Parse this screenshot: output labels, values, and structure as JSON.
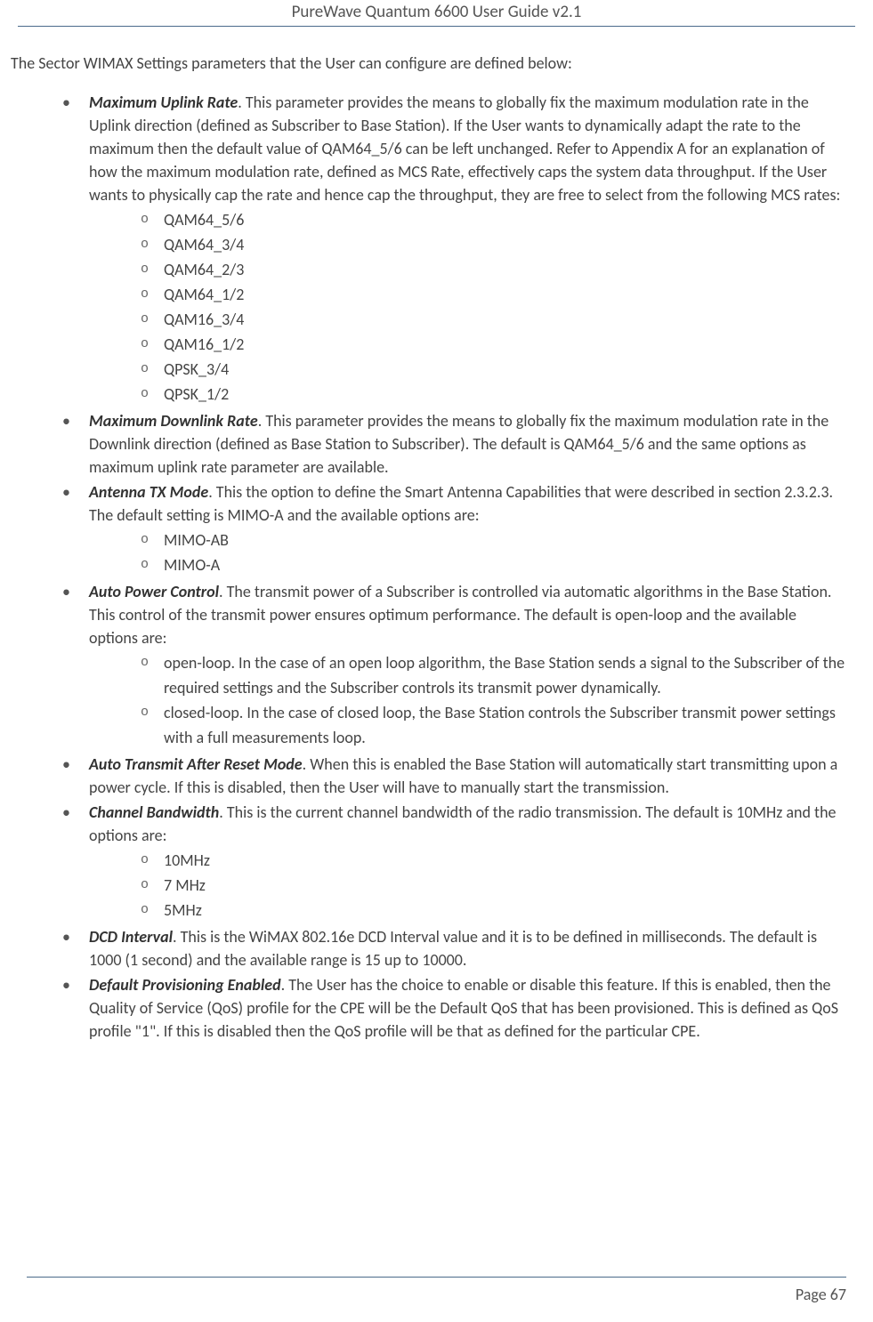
{
  "header": {
    "title": "PureWave Quantum 6600 User Guide v2.1"
  },
  "intro": "The Sector WIMAX Settings parameters that the User can configure are defined below:",
  "params": [
    {
      "term": "Maximum Uplink Rate",
      "desc": ". This parameter provides the means to globally fix the maximum modulation rate in the Uplink direction (defined as Subscriber to Base Station). If the User wants to dynamically adapt the rate to the maximum then the default value of QAM64_5/6 can be left unchanged. Refer to Appendix A for an explanation of how the maximum modulation rate, defined as MCS Rate, effectively caps the system data throughput. If the User wants to physically cap the rate and hence cap the throughput, they are free to select from the following MCS rates:",
      "sub": [
        "QAM64_5/6",
        "QAM64_3/4",
        "QAM64_2/3",
        "QAM64_1/2",
        "QAM16_3/4",
        "QAM16_1/2",
        "QPSK_3/4",
        "QPSK_1/2"
      ]
    },
    {
      "term": "Maximum Downlink Rate",
      "desc": ". This parameter provides the means to globally fix the maximum modulation rate in the Downlink direction (defined as Base Station to Subscriber). The default is QAM64_5/6 and the same options as maximum uplink rate parameter are available.",
      "sub": []
    },
    {
      "term": "Antenna TX Mode",
      "desc": ". This the option to define the Smart Antenna Capabilities that were described in section 2.3.2.3. The default setting is MIMO-A and the available options are:",
      "sub": [
        "MIMO-AB",
        "MIMO-A"
      ]
    },
    {
      "term": "Auto Power Control",
      "desc": ". The transmit power of a Subscriber is controlled via automatic algorithms in the Base Station. This control of the transmit power ensures optimum performance. The default is open-loop and the available options are:",
      "sub": [
        "open-loop. In the case of an open loop algorithm, the Base Station sends a signal to the Subscriber of the required settings and the Subscriber controls its transmit power dynamically.",
        "closed-loop. In the case of closed loop, the Base Station controls the Subscriber transmit power settings with a full measurements loop."
      ]
    },
    {
      "term": "Auto Transmit After Reset Mode",
      "desc": ". When this is enabled the Base Station will automatically start transmitting upon a power cycle. If this is disabled, then the User will have to manually start the transmission.",
      "sub": []
    },
    {
      "term": "Channel Bandwidth",
      "desc": ". This is the current channel bandwidth of the radio transmission. The default is 10MHz and the options are:",
      "sub": [
        "10MHz",
        "7 MHz",
        "5MHz"
      ]
    },
    {
      "term": "DCD Interval",
      "desc": ". This is the WiMAX 802.16e DCD Interval value and it is to be defined in milliseconds. The default is 1000 (1 second) and the available range is 15 up to 10000.",
      "sub": []
    },
    {
      "term": "Default Provisioning Enabled",
      "desc": ". The User has the choice to enable or disable this feature. If this is enabled, then the Quality of Service (QoS) profile for the CPE will be the Default QoS that has been provisioned. This is defined as QoS profile \"1\". If this is disabled then the QoS profile will be that as defined for the particular CPE.",
      "sub": []
    }
  ],
  "footer": {
    "page": "Page 67"
  }
}
